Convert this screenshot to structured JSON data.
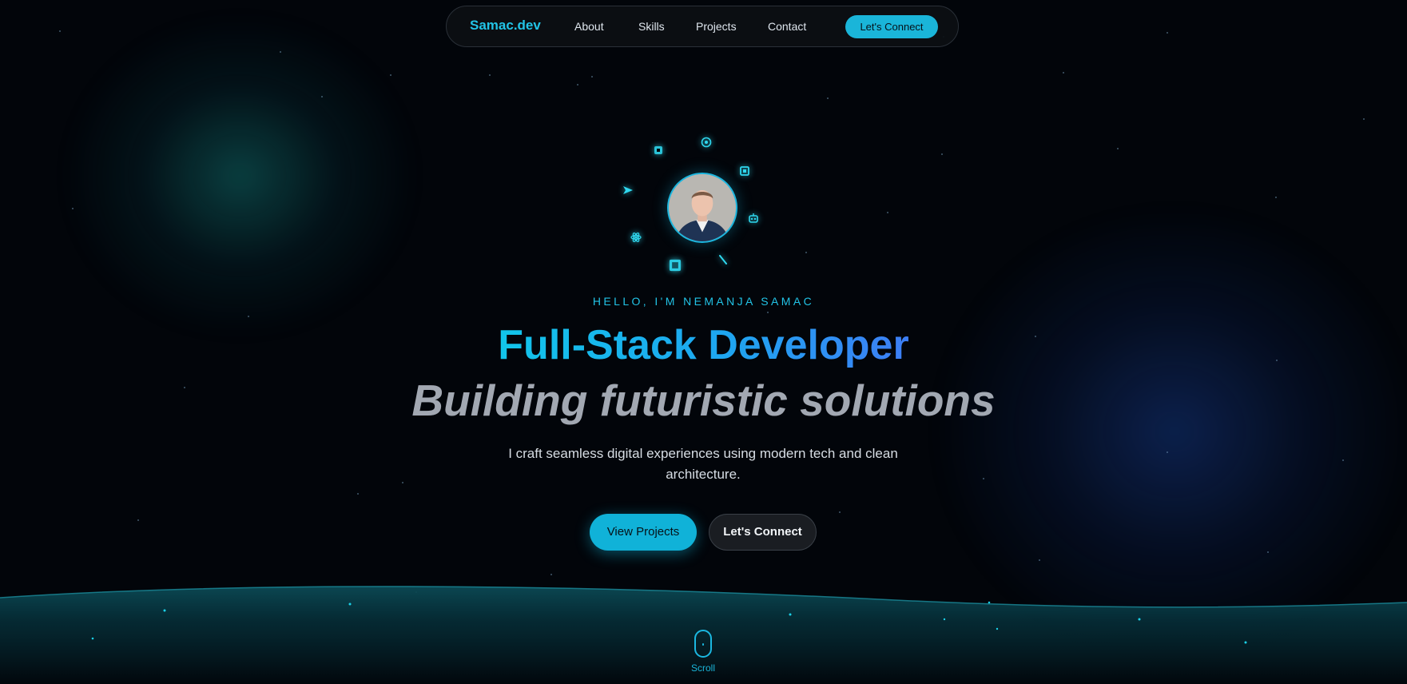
{
  "nav": {
    "brand": "Samac.dev",
    "links": [
      "About",
      "Skills",
      "Projects",
      "Contact"
    ],
    "cta": "Let's Connect"
  },
  "hero": {
    "greeting": "HELLO, I'M NEMANJA SAMAC",
    "title": "Full-Stack Developer",
    "subtitle": "Building futuristic solutions",
    "description": "I craft seamless digital experiences using modern tech and clean architecture.",
    "primary_button": "View Projects",
    "secondary_button": "Let's Connect"
  },
  "scroll": {
    "label": "Scroll"
  },
  "colors": {
    "accent": "#1ab5d9",
    "background": "#02050a",
    "subtitle": "#a2a8b2",
    "glow_left": "#106e6c",
    "glow_right": "#143782"
  },
  "icons": [
    "logo-icon",
    "react-icon",
    "code-box-icon",
    "send-icon",
    "robot-icon",
    "atom-icon",
    "stack-icon",
    "pen-icon",
    "mouse-icon"
  ]
}
